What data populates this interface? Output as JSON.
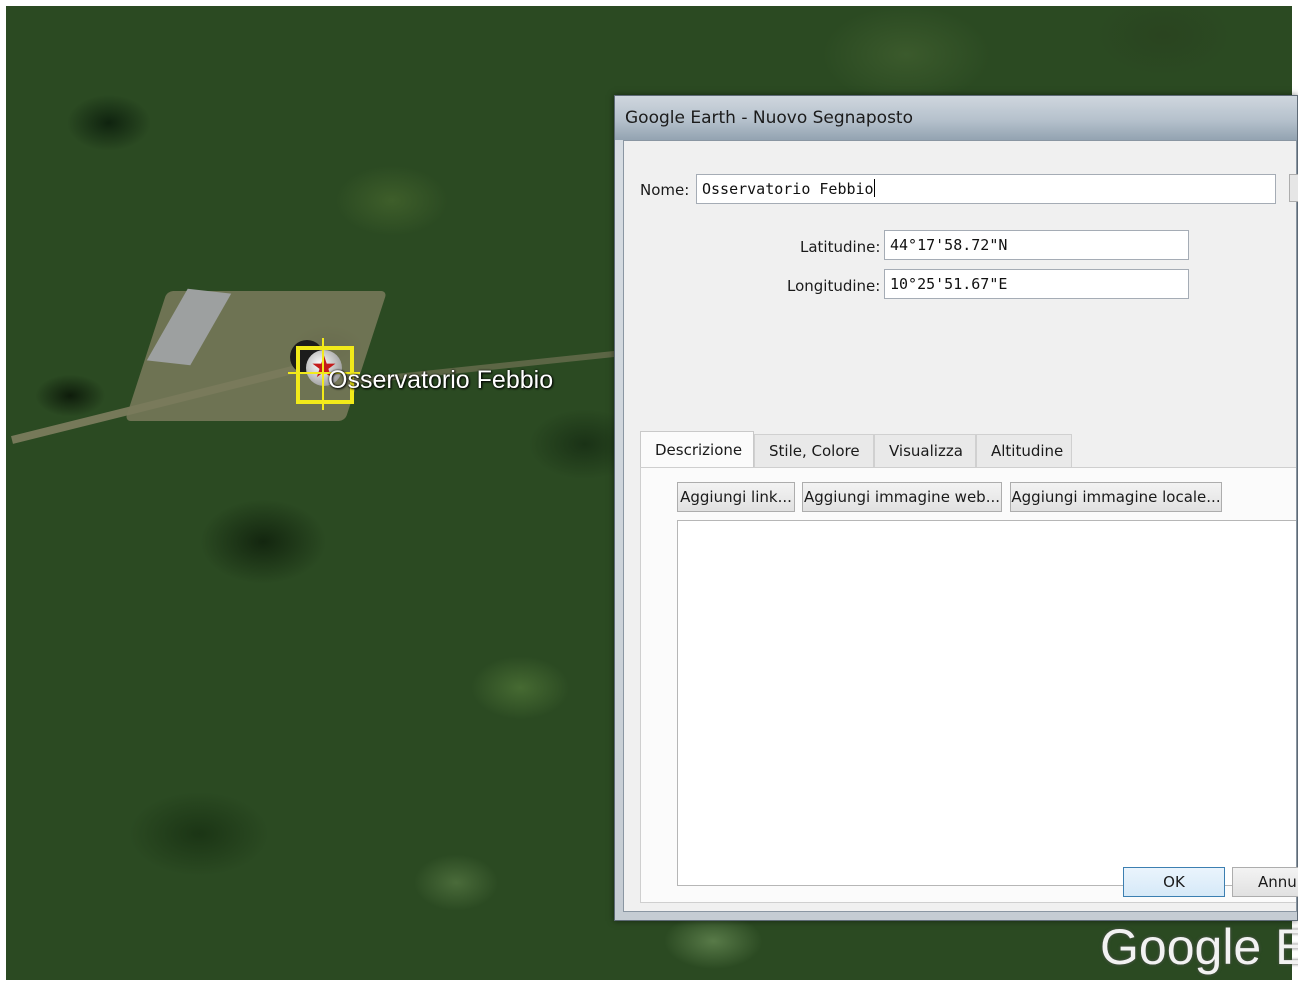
{
  "map": {
    "placemark_label": "Osservatorio Febbio",
    "placemark_icon": "red-star-icon",
    "watermark": "Google Ea"
  },
  "dialog": {
    "title": "Google Earth - Nuovo Segnaposto",
    "name_label": "Nome:",
    "name_value": "Osservatorio Febbio",
    "latitude_label": "Latitudine:",
    "latitude_value": "44°17'58.72\"N",
    "longitude_label": "Longitudine:",
    "longitude_value": "10°25'51.67\"E",
    "tabs": [
      {
        "label": "Descrizione",
        "active": true
      },
      {
        "label": "Stile, Colore",
        "active": false
      },
      {
        "label": "Visualizza",
        "active": false
      },
      {
        "label": "Altitudine",
        "active": false
      }
    ],
    "description_buttons": {
      "add_link": "Aggiungi link...",
      "add_web_image": "Aggiungi immagine web...",
      "add_local_image": "Aggiungi immagine locale..."
    },
    "ok_label": "OK",
    "cancel_label": "Annu"
  },
  "colors": {
    "placemark_frame": "#f2ea1a",
    "placemark_star": "#c41a1a",
    "ok_button_border": "#3c7fb1"
  }
}
